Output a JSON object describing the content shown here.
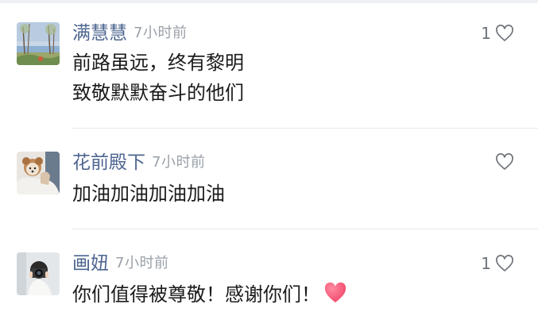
{
  "comments": [
    {
      "user": "满慧慧",
      "time": "7小时前",
      "likes": "1",
      "lines": [
        "前路虽远，终有黎明",
        "致敬默默奋斗的他们"
      ],
      "avatar": "landscape-painting-avatar"
    },
    {
      "user": "花前殿下",
      "time": "7小时前",
      "likes": "",
      "lines": [
        "加油加油加油加油"
      ],
      "avatar": "person-with-dog-avatar"
    },
    {
      "user": "画妞",
      "time": "7小时前",
      "likes": "1",
      "lines": [
        "你们值得被尊敬！感谢你们！"
      ],
      "avatar": "person-with-camera-avatar",
      "emoji": "red-heart-emoji"
    }
  ],
  "icons": {
    "like": "heart-outline-icon",
    "emoji": "red-heart-emoji"
  },
  "colors": {
    "username": "#4d6590",
    "timestamp": "#9aa0a8",
    "body_text": "#1b1b1b",
    "heart_emoji": "#f0476a"
  }
}
